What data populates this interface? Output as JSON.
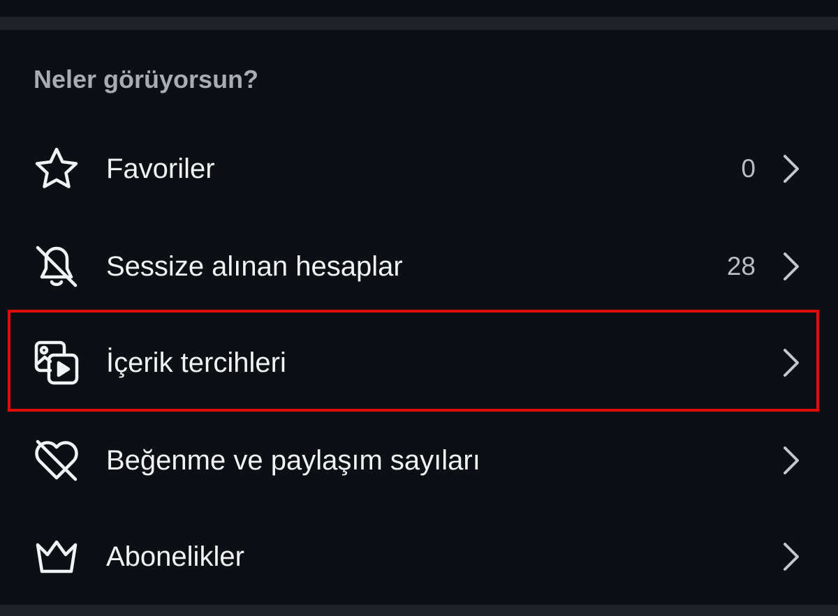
{
  "section": {
    "title": "Neler görüyorsun?"
  },
  "items": [
    {
      "label": "Favoriler",
      "count": "0",
      "icon": "star-icon"
    },
    {
      "label": "Sessize alınan hesaplar",
      "count": "28",
      "icon": "bell-off-icon"
    },
    {
      "label": "İçerik tercihleri",
      "count": "",
      "icon": "media-content-icon"
    },
    {
      "label": "Beğenme ve paylaşım sayıları",
      "count": "",
      "icon": "heart-off-icon"
    },
    {
      "label": "Abonelikler",
      "count": "",
      "icon": "crown-icon"
    }
  ],
  "colors": {
    "background": "#0c0f14",
    "divider": "#1f2227",
    "section_title": "#a7acb5",
    "text": "#f2f3f5",
    "count": "#b9bdc4",
    "highlight": "#e00b0b"
  }
}
